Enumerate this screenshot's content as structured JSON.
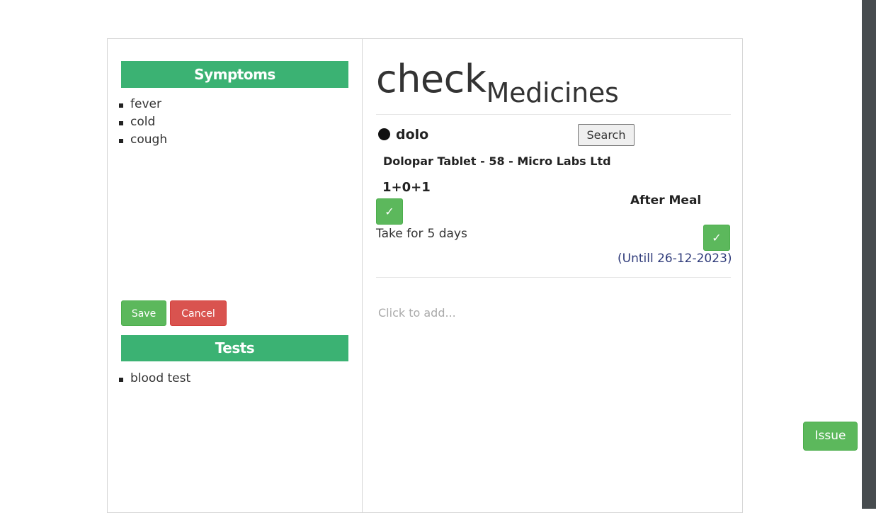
{
  "symptoms": {
    "header": "Symptoms",
    "items": [
      "fever",
      "cold",
      "cough"
    ]
  },
  "actions": {
    "save_label": "Save",
    "cancel_label": "Cancel"
  },
  "tests": {
    "header": "Tests",
    "items": [
      "blood test"
    ]
  },
  "medicines": {
    "title_main": "check",
    "title_sub": "Medicines",
    "entry": {
      "search_term": "dolo",
      "search_label": "Search",
      "product": "Dolopar Tablet - 58 - Micro Labs Ltd",
      "dosage": "1+0+1",
      "timing": "After Meal",
      "confirm_glyph": "✓",
      "take_for_label": "Take for",
      "duration": "5 days",
      "until": "(Untill 26-12-2023)"
    },
    "add_placeholder": "Click to add..."
  },
  "issue_label": "Issue",
  "colors": {
    "section_header": "#3bb273",
    "success": "#5cb85c",
    "danger": "#d9534f",
    "until_text": "#2f3b7a",
    "scrollbar": "#474c4f"
  },
  "icons": {
    "bullet": "filled-circle-icon",
    "confirm": "checkmark-icon"
  }
}
